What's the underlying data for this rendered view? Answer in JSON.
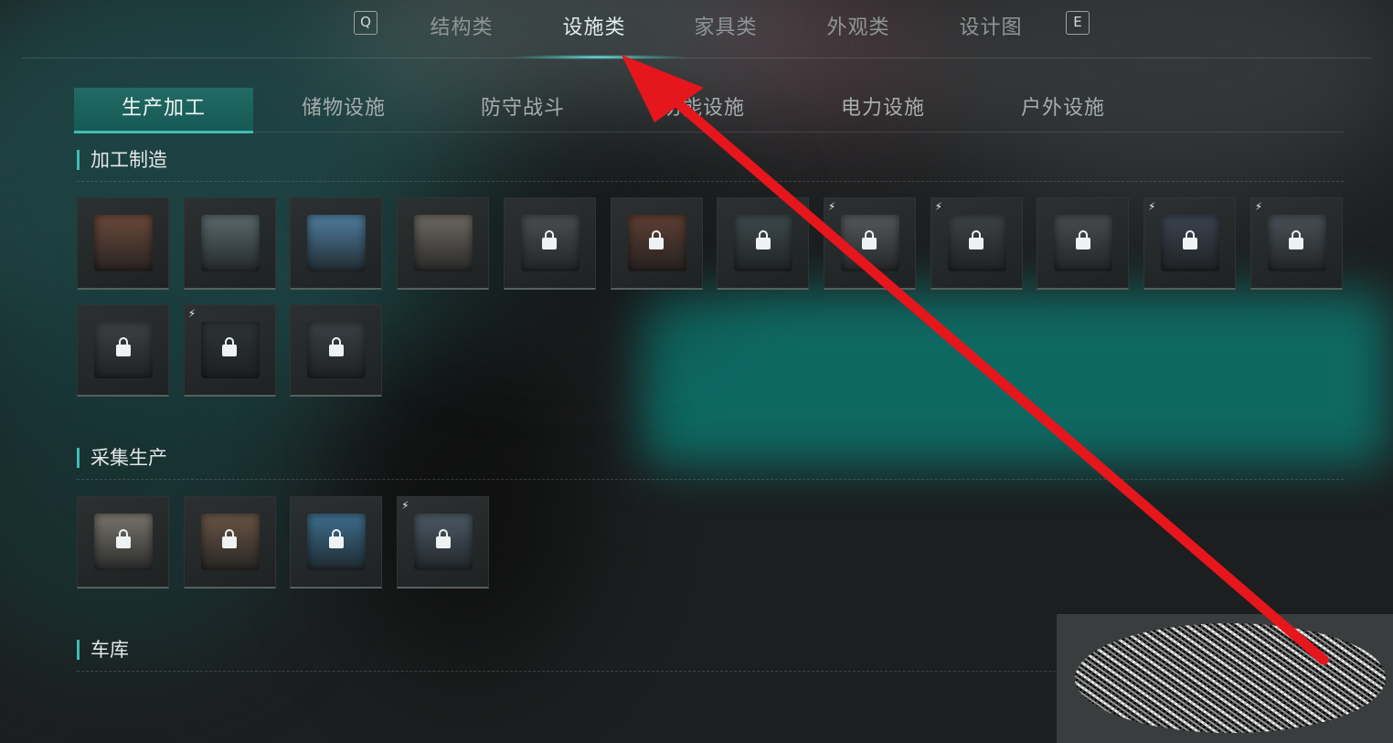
{
  "top_nav": {
    "key_left": "Q",
    "key_right": "E",
    "tabs": [
      {
        "label": "结构类",
        "active": false
      },
      {
        "label": "设施类",
        "active": true
      },
      {
        "label": "家具类",
        "active": false
      },
      {
        "label": "外观类",
        "active": false
      },
      {
        "label": "设计图",
        "active": false
      }
    ]
  },
  "sub_nav": {
    "tabs": [
      {
        "label": "生产加工",
        "active": true
      },
      {
        "label": "储物设施",
        "active": false
      },
      {
        "label": "防守战斗",
        "active": false
      },
      {
        "label": "功能设施",
        "active": false
      },
      {
        "label": "电力设施",
        "active": false
      },
      {
        "label": "户外设施",
        "active": false
      }
    ]
  },
  "sections": [
    {
      "title": "加工制造",
      "items": [
        {
          "icon": "workbench-icon",
          "locked": false,
          "powered": false
        },
        {
          "icon": "tool-bench-icon",
          "locked": false,
          "powered": false
        },
        {
          "icon": "blue-crafting-table-icon",
          "locked": false,
          "powered": false
        },
        {
          "icon": "loom-machine-icon",
          "locked": false,
          "powered": false
        },
        {
          "icon": "cabinet-machine-icon",
          "locked": true,
          "powered": false
        },
        {
          "icon": "wood-workbench-icon",
          "locked": true,
          "powered": false
        },
        {
          "icon": "metal-workbench-icon",
          "locked": true,
          "powered": false
        },
        {
          "icon": "electric-cabinet-icon",
          "locked": true,
          "powered": true
        },
        {
          "icon": "electric-workstation-icon",
          "locked": true,
          "powered": true
        },
        {
          "icon": "drafting-table-icon",
          "locked": true,
          "powered": false
        },
        {
          "icon": "barrel-machine-icon",
          "locked": true,
          "powered": true
        },
        {
          "icon": "industrial-machine-icon",
          "locked": true,
          "powered": true
        },
        {
          "icon": "stove-icon",
          "locked": true,
          "powered": false
        },
        {
          "icon": "tall-generator-icon",
          "locked": true,
          "powered": true
        },
        {
          "icon": "tower-rack-icon",
          "locked": true,
          "powered": false
        }
      ]
    },
    {
      "title": "采集生产",
      "items": [
        {
          "icon": "dirt-pile-icon",
          "locked": true,
          "powered": false
        },
        {
          "icon": "planter-box-icon",
          "locked": true,
          "powered": false
        },
        {
          "icon": "water-collector-icon",
          "locked": true,
          "powered": false
        },
        {
          "icon": "electric-collector-icon",
          "locked": true,
          "powered": true
        }
      ]
    },
    {
      "title": "车库",
      "items": []
    }
  ],
  "colors": {
    "accent": "#3dbdb1",
    "arrow": "#e5161c",
    "teal_bg": "#0f5e58"
  }
}
